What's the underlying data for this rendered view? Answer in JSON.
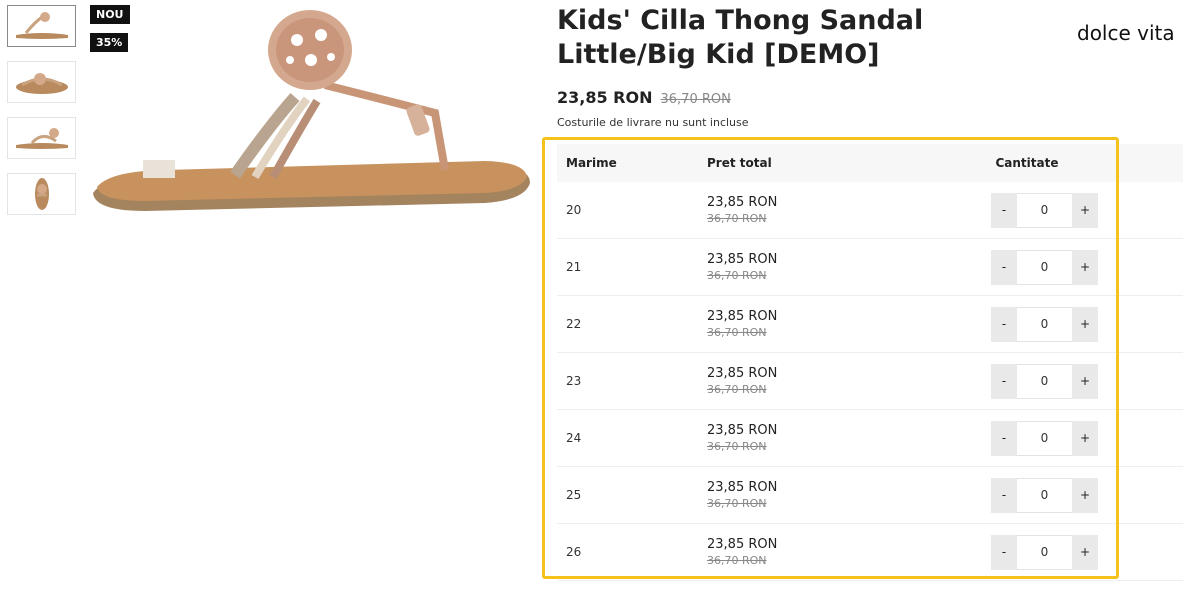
{
  "product": {
    "title": "Kids' Cilla Thong Sandal Little/Big Kid [DEMO]",
    "brand": "dolce vita",
    "price_current": "23,85 RON",
    "price_old": "36,70 RON",
    "shipping_note": "Costurile de livrare nu sunt incluse"
  },
  "badges": {
    "new": "NOU",
    "discount": "35%"
  },
  "table": {
    "headers": {
      "size": "Marime",
      "price": "Pret total",
      "quantity": "Cantitate"
    },
    "rows": [
      {
        "size": "20",
        "price": "23,85 RON",
        "old_price": "36,70 RON",
        "qty": "0"
      },
      {
        "size": "21",
        "price": "23,85 RON",
        "old_price": "36,70 RON",
        "qty": "0"
      },
      {
        "size": "22",
        "price": "23,85 RON",
        "old_price": "36,70 RON",
        "qty": "0"
      },
      {
        "size": "23",
        "price": "23,85 RON",
        "old_price": "36,70 RON",
        "qty": "0"
      },
      {
        "size": "24",
        "price": "23,85 RON",
        "old_price": "36,70 RON",
        "qty": "0"
      },
      {
        "size": "25",
        "price": "23,85 RON",
        "old_price": "36,70 RON",
        "qty": "0"
      },
      {
        "size": "26",
        "price": "23,85 RON",
        "old_price": "36,70 RON",
        "qty": "0"
      }
    ],
    "minus_label": "-",
    "plus_label": "+"
  },
  "colors": {
    "highlight": "#f4c21a",
    "badge_bg": "#111111",
    "stepper_bg": "#e9e9e9"
  }
}
